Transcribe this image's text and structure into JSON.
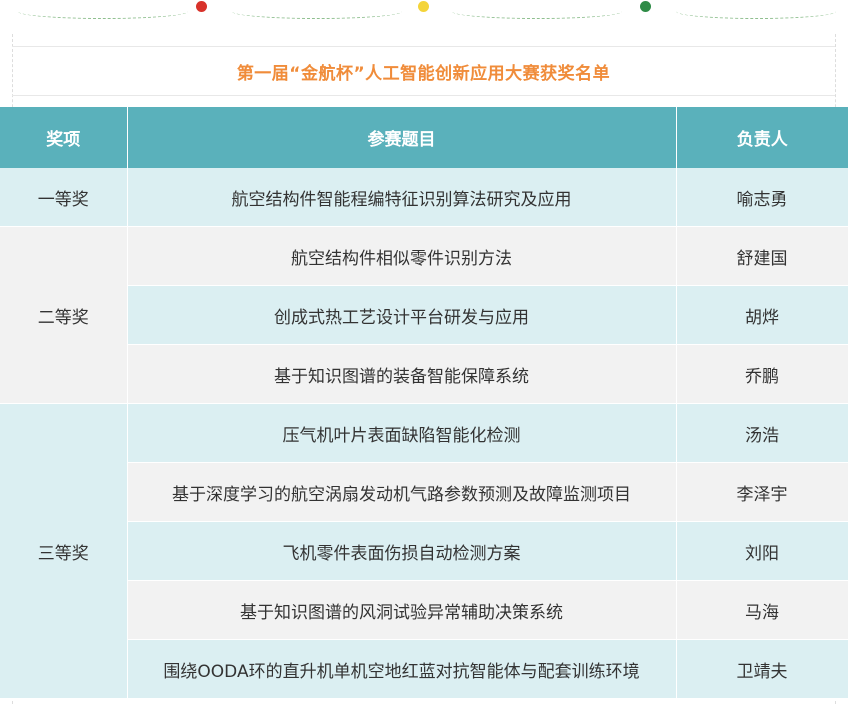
{
  "decoration": {
    "dot_colors": [
      "#d8322a",
      "#f4d43a",
      "#2e8b46"
    ]
  },
  "title": "第一届“金航杯”人工智能创新应用大赛获奖名单",
  "table": {
    "headers": {
      "award": "奖项",
      "topic": "参赛题目",
      "leader": "负责人"
    },
    "groups": [
      {
        "award": "一等奖",
        "rows": [
          {
            "topic": "航空结构件智能程编特征识别算法研究及应用",
            "leader": "喻志勇"
          }
        ]
      },
      {
        "award": "二等奖",
        "rows": [
          {
            "topic": "航空结构件相似零件识别方法",
            "leader": "舒建国"
          },
          {
            "topic": "创成式热工艺设计平台研发与应用",
            "leader": "胡烨"
          },
          {
            "topic": "基于知识图谱的装备智能保障系统",
            "leader": "乔鹏"
          }
        ]
      },
      {
        "award": "三等奖",
        "rows": [
          {
            "topic": "压气机叶片表面缺陷智能化检测",
            "leader": "汤浩"
          },
          {
            "topic": "基于深度学习的航空涡扇发动机气路参数预测及故障监测项目",
            "leader": "李泽宇"
          },
          {
            "topic": "飞机零件表面伤损自动检测方案",
            "leader": "刘阳"
          },
          {
            "topic": "基于知识图谱的风洞试验异常辅助决策系统",
            "leader": "马海"
          },
          {
            "topic": "围绕OODA环的直升机单机空地红蓝对抗智能体与配套训练环境",
            "leader": "卫靖夫"
          }
        ]
      }
    ]
  }
}
